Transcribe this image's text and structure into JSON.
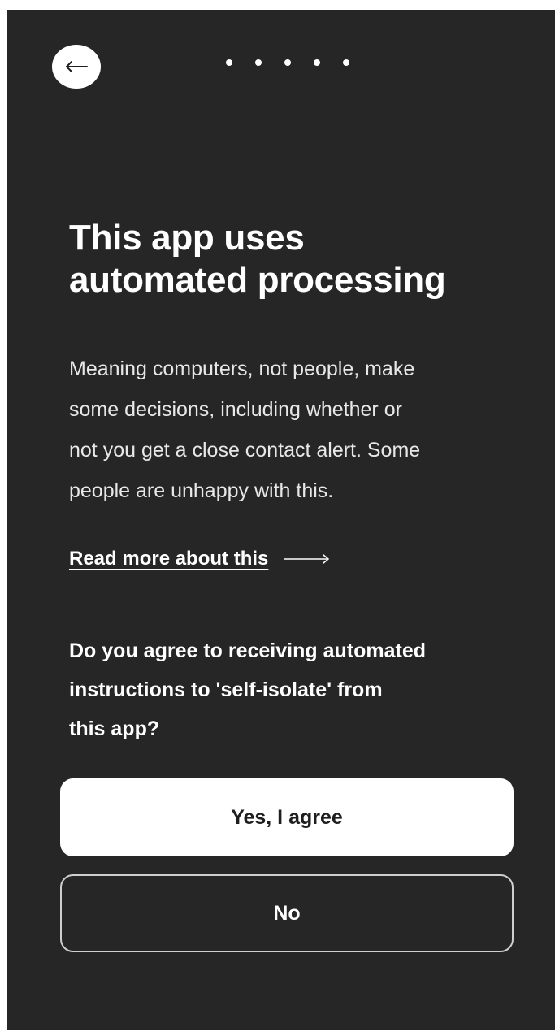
{
  "header": {
    "back_icon": "arrow-left-icon",
    "progress_steps": 5
  },
  "content": {
    "title_line_1": "This app uses",
    "title_line_2": "automated processing",
    "body_line_1": "Meaning computers, not people, make",
    "body_line_2": "some decisions, including whether or",
    "body_line_3": "not you get a close contact alert. Some",
    "body_line_4": "people are unhappy with this.",
    "read_more_label": "Read more about this",
    "read_more_icon": "arrow-right-icon",
    "question_line_1": "Do you agree to receiving automated",
    "question_line_2": "instructions to 'self-isolate' from",
    "question_line_3": "this app?"
  },
  "actions": {
    "yes_label": "Yes, I agree",
    "no_label": "No"
  },
  "colors": {
    "background": "#262626",
    "primary_button": "#ffffff",
    "text": "#ffffff"
  }
}
